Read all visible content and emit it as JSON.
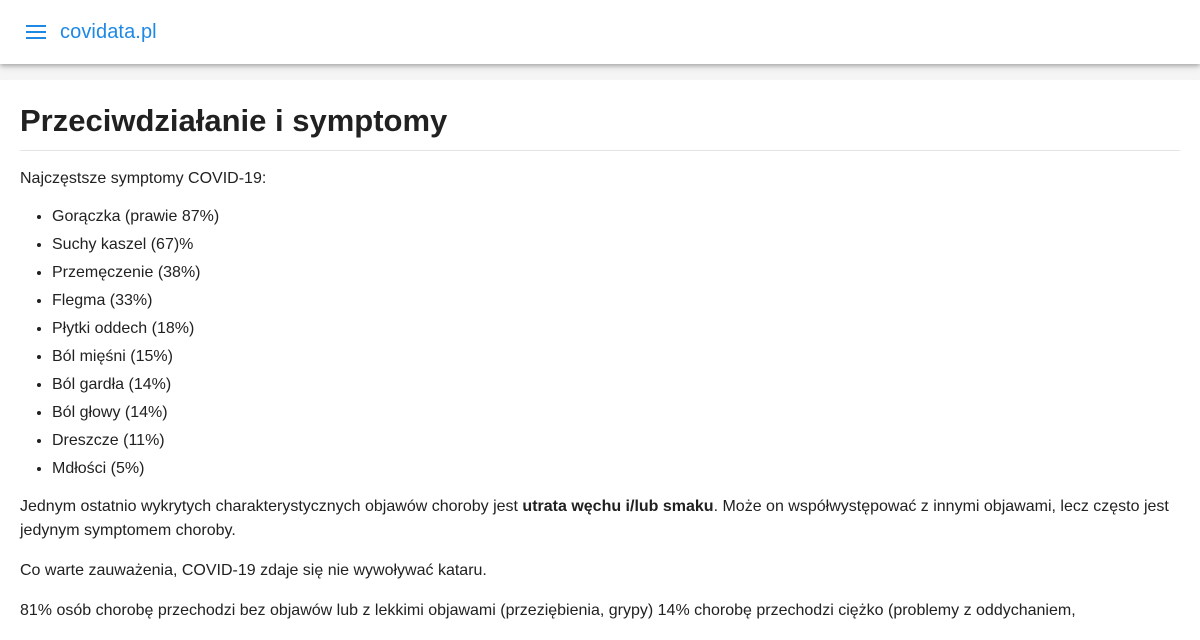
{
  "header": {
    "menu_icon": "hamburger-menu-icon",
    "brand": "covidata.pl",
    "brand_color": "#1e88e5"
  },
  "page": {
    "title": "Przeciwdziałanie i symptomy",
    "intro": "Najczęstsze symptomy COVID-19:",
    "symptoms": [
      "Gorączka (prawie 87%)",
      "Suchy kaszel (67)%",
      "Przemęczenie (38%)",
      "Flegma (33%)",
      "Płytki oddech (18%)",
      "Ból mięśni (15%)",
      "Ból gardła (14%)",
      "Ból głowy (14%)",
      "Dreszcze (11%)",
      "Mdłości (5%)"
    ],
    "paragraph1": {
      "before": "Jednym ostatnio wykrytych charakterystycznych objawów choroby jest ",
      "bold": "utrata węchu i/lub smaku",
      "after": ". Może on współwystępować z innymi objawami, lecz często jest jedynym symptomem choroby."
    },
    "paragraph2": "Co warte zauważenia, COVID-19 zdaje się nie wywoływać kataru.",
    "paragraph3": "81% osób chorobę przechodzi bez objawów lub z lekkimi objawami (przeziębienia, grypy) 14% chorobę przechodzi ciężko (problemy z oddychaniem,"
  }
}
